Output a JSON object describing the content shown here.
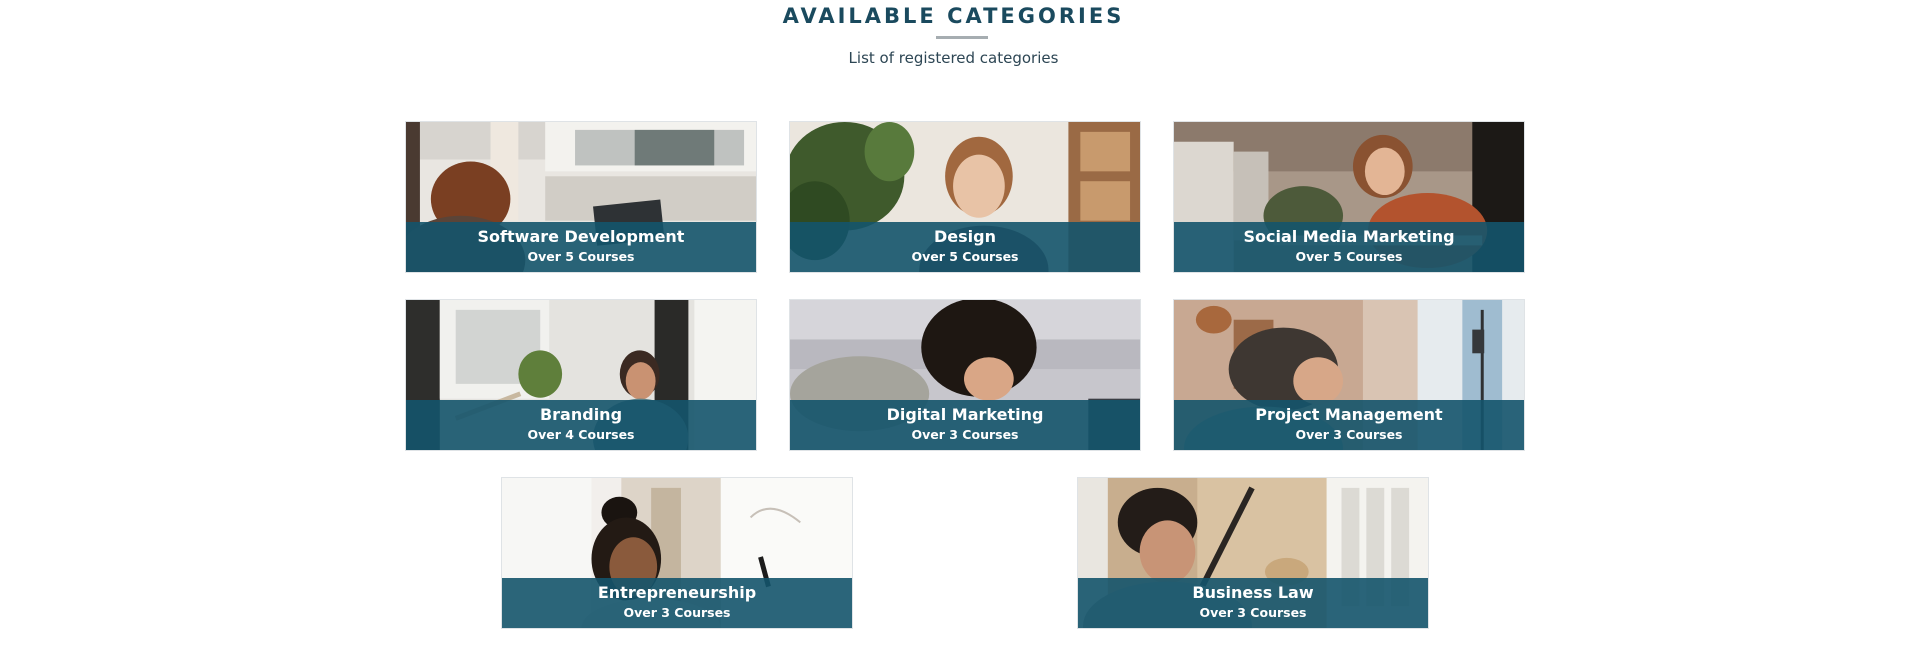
{
  "header": {
    "title": "AVAILABLE CATEGORIES",
    "subtitle": "List of registered categories"
  },
  "colors": {
    "title": "#1a4a5e",
    "overlay": "#14546b",
    "underline": "#a6adb1"
  },
  "categories": [
    {
      "title": "Software Development",
      "count": "Over 5 Courses",
      "image": "woman-at-laptop-photo"
    },
    {
      "title": "Design",
      "count": "Over 5 Courses",
      "image": "smiling-woman-with-plants-photo"
    },
    {
      "title": "Social Media Marketing",
      "count": "Over 5 Courses",
      "image": "woman-leaning-on-desk-photo"
    },
    {
      "title": "Branding",
      "count": "Over 4 Courses",
      "image": "man-in-office-photo"
    },
    {
      "title": "Digital Marketing",
      "count": "Over 3 Courses",
      "image": "curly-haired-woman-writing-photo"
    },
    {
      "title": "Project Management",
      "count": "Over 3 Courses",
      "image": "woman-with-phone-tripod-photo"
    },
    {
      "title": "Entrepreneurship",
      "count": "Over 3 Courses",
      "image": "woman-at-whiteboard-photo"
    },
    {
      "title": "Business Law",
      "count": "Over 3 Courses",
      "image": "man-reading-photo"
    }
  ]
}
